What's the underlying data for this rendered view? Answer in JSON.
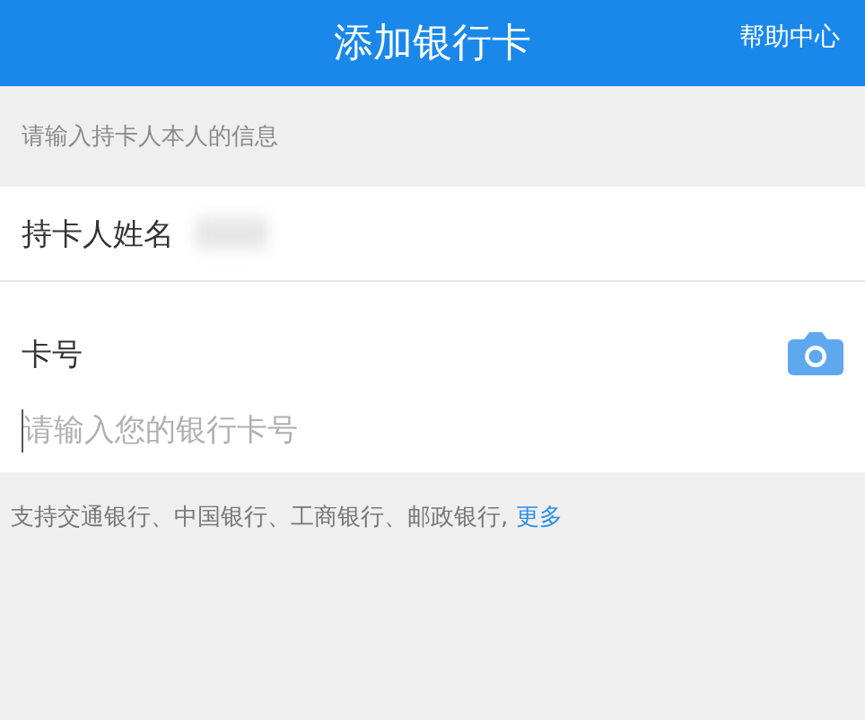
{
  "header": {
    "title": "添加银行卡",
    "help_link": "帮助中心"
  },
  "section_hint": "请输入持卡人本人的信息",
  "name_row": {
    "label": "持卡人姓名"
  },
  "card_row": {
    "label": "卡号",
    "placeholder": "请输入您的银行卡号"
  },
  "support_note": {
    "text": "支持交通银行、中国银行、工商银行、邮政银行,",
    "link": "更多"
  }
}
